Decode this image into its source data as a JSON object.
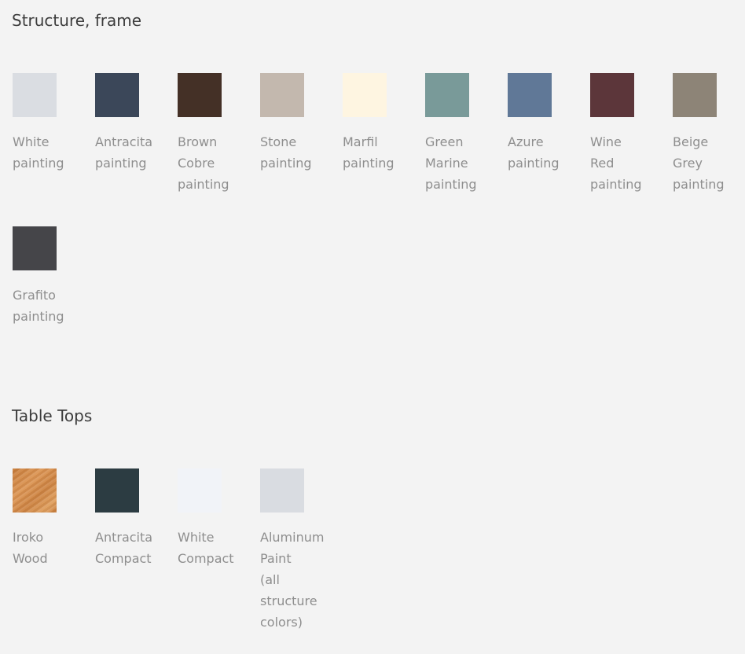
{
  "sections": [
    {
      "title": "Structure, frame",
      "swatches": [
        {
          "name": "White painting",
          "color": "#dadde2"
        },
        {
          "name": "Antracita painting",
          "color": "#3b4759"
        },
        {
          "name": "Brown Cobre painting",
          "color": "#443026"
        },
        {
          "name": "Stone painting",
          "color": "#c3b8ae"
        },
        {
          "name": "Marfil painting",
          "color": "#fef5e1"
        },
        {
          "name": "Green Marine painting",
          "color": "#799a99"
        },
        {
          "name": "Azure painting",
          "color": "#607897"
        },
        {
          "name": "Wine Red painting",
          "color": "#5c363a"
        },
        {
          "name": "Beige Grey painting",
          "color": "#8d8477"
        },
        {
          "name": "Grafito painting",
          "color": "#454549"
        }
      ]
    },
    {
      "title": "Table Tops",
      "swatches": [
        {
          "name": "Iroko Wood",
          "color": "#d18a47",
          "texture": "wood"
        },
        {
          "name": "Antracita Compact",
          "color": "#2c3c42"
        },
        {
          "name": "White Compact",
          "color": "#f1f3f8"
        },
        {
          "name": "Aluminum Paint (all structure colors)",
          "color": "#d9dce1"
        }
      ]
    }
  ]
}
